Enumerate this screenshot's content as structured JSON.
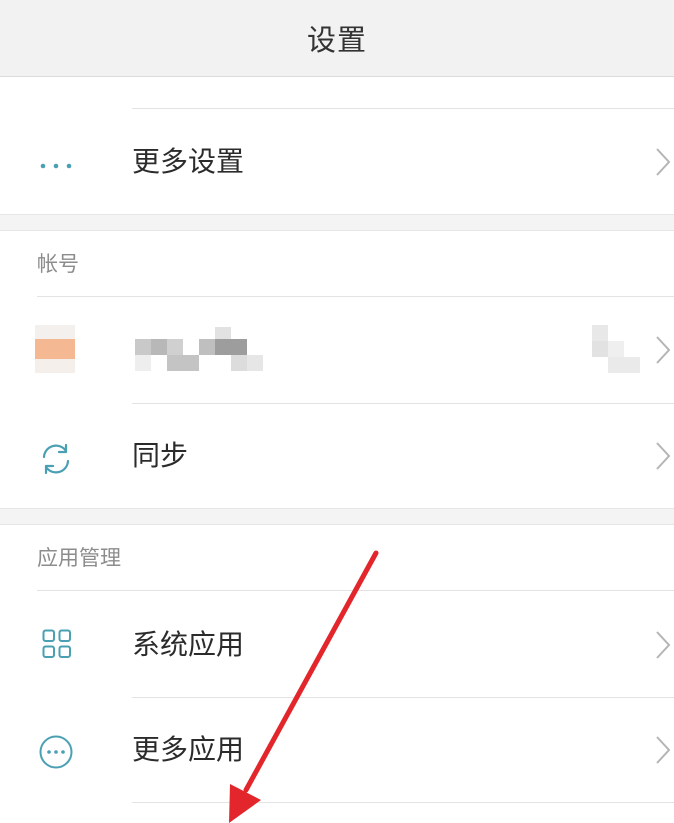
{
  "header": {
    "title": "设置"
  },
  "rows": {
    "more_settings": {
      "label": "更多设置",
      "icon": "more-dots-icon"
    },
    "sync": {
      "label": "同步",
      "icon": "sync-icon"
    },
    "system_apps": {
      "label": "系统应用",
      "icon": "grid-apps-icon"
    },
    "more_apps": {
      "label": "更多应用",
      "icon": "more-circle-icon"
    }
  },
  "sections": {
    "account": {
      "title": "帐号"
    },
    "app_management": {
      "title": "应用管理"
    }
  },
  "colors": {
    "accent": "#4aa0b2",
    "annotation_arrow": "#e3262b",
    "text_primary": "#2b2b2b",
    "text_secondary": "#8c8c8c"
  }
}
